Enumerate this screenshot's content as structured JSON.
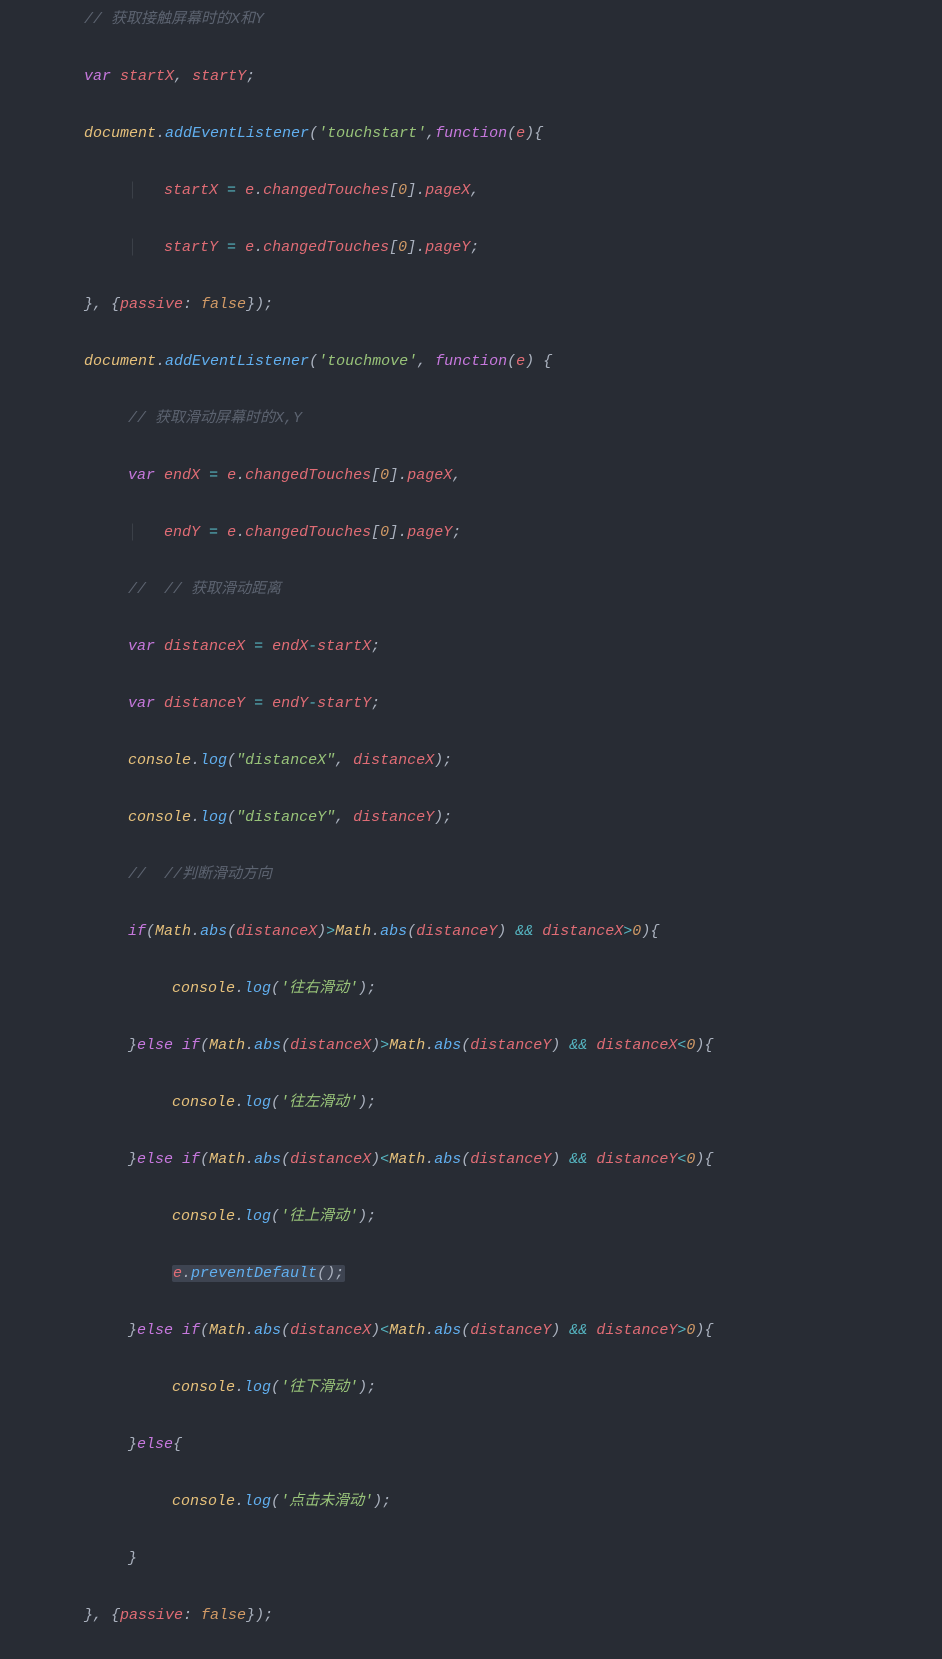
{
  "code": {
    "line1": "// 获取接触屏幕时的X和Y",
    "line2_var": "var",
    "line2_startX": "startX",
    "line2_startY": "startY",
    "line3_doc": "document",
    "line3_addEvt": "addEventListener",
    "line3_str": "'touchstart'",
    "line3_fn": "function",
    "line3_e": "e",
    "line4_startX": "startX",
    "line4_e": "e",
    "line4_ct": "changedTouches",
    "line4_idx": "0",
    "line4_pageX": "pageX",
    "line5_startY": "startY",
    "line5_pageY": "pageY",
    "line6_passive": "passive",
    "line6_false": "false",
    "line7_str": "'touchmove'",
    "line8": "// 获取滑动屏幕时的X,Y",
    "line9_endX": "endX",
    "line10_endY": "endY",
    "line11": "//  // 获取滑动距离",
    "line12_distX": "distanceX",
    "line13_distY": "distanceY",
    "line14_console": "console",
    "line14_log": "log",
    "line14_str": "\"distanceX\"",
    "line15_str": "\"distanceY\"",
    "line16": "//  //判断滑动方向",
    "line17_if": "if",
    "line17_Math": "Math",
    "line17_abs": "abs",
    "line17_and": "&&",
    "line18_str": "'往右滑动'",
    "line19_else": "else",
    "line20_str": "'往左滑动'",
    "line22_str": "'往上滑动'",
    "line23_prevent": "preventDefault",
    "line25_str": "'往下滑动'",
    "line27_str": "'点击未滑动'"
  }
}
